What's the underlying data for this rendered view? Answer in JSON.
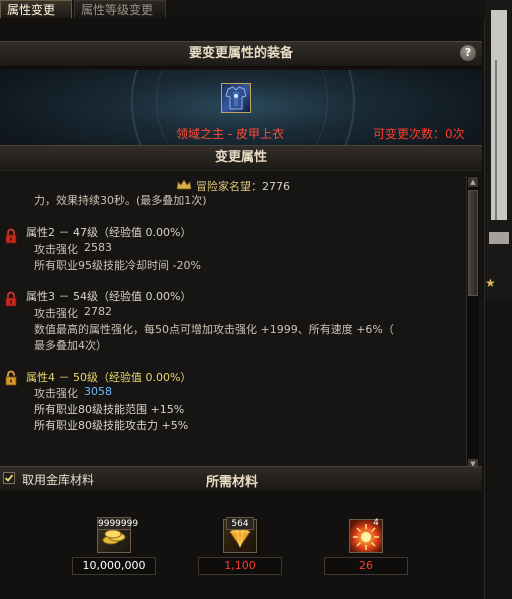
{
  "tabs": [
    {
      "label": "属性变更"
    },
    {
      "label": "属性等级变更"
    }
  ],
  "equip_section": {
    "title": "要变更属性的装备",
    "help_symbol": "?",
    "equip_name": "领域之主 - 皮甲上衣",
    "change_count": "可变更次数：0次",
    "equip_icon": "armor-chest-icon"
  },
  "change_section": {
    "title": "变更属性",
    "reputation_label": "冒险家名望：",
    "reputation_value": "2776",
    "lines": {
      "l0": "力，效果持续30秒。(最多叠加1次)",
      "p2_header": "属性2 － 47级（经验值 0.00%）",
      "p2_attack_label": "攻击强化",
      "p2_attack_value": "2583",
      "p2_desc": "所有职业95级技能冷却时间 -20%",
      "p3_header": "属性3 － 54级（经验值 0.00%）",
      "p3_attack_label": "攻击强化",
      "p3_attack_value": "2782",
      "p3_desc1": "数值最高的属性强化，每50点可增加攻击强化 +1999、所有速度 +6%（",
      "p3_desc2": "最多叠加4次）",
      "p4_header": "属性4 － 50级（经验值 0.00%）",
      "p4_attack_label": "攻击强化",
      "p4_attack_value": "3058",
      "p4_desc1": "所有职业80级技能范围 +15%",
      "p4_desc2": "所有职业80级技能攻击力 +5%"
    }
  },
  "materials_section": {
    "use_storage_label": "取用金库材料",
    "title": "所需材料",
    "items": [
      {
        "icon": "gold-coins-icon",
        "count": "9999999",
        "value": "10,000,000"
      },
      {
        "icon": "crystal-gem-icon",
        "count": "564",
        "value": "1,100"
      },
      {
        "icon": "burst-orb-icon",
        "count": "4",
        "value": "26"
      }
    ]
  },
  "colors": {
    "accent_gold": "#e8d56e",
    "alert_red": "#ff3b2c",
    "value_blue": "#6fb8ff"
  }
}
